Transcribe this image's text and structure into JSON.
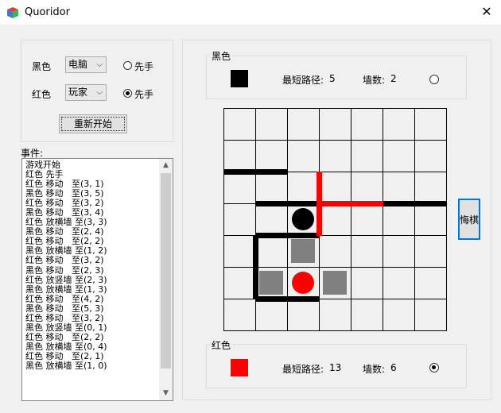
{
  "window": {
    "title": "Quoridor",
    "close_glyph": "✕"
  },
  "settings": {
    "black_label": "黑色",
    "black_controller": "电脑",
    "red_label": "红色",
    "red_controller": "玩家",
    "first_label": "先手",
    "black_first_selected": false,
    "red_first_selected": true,
    "restart_label": "重新开始"
  },
  "events": {
    "label": "事件:",
    "items": [
      "游戏开始",
      "红色 先手",
      "红色 移动   至(3, 1)",
      "黑色 移动   至(3, 5)",
      "红色 移动   至(3, 2)",
      "黑色 移动   至(3, 4)",
      "红色 放横墙 至(3, 3)",
      "黑色 移动   至(2, 4)",
      "红色 移动   至(2, 2)",
      "黑色 放横墙 至(1, 2)",
      "红色 移动   至(3, 2)",
      "黑色 移动   至(2, 3)",
      "红色 放竖墙 至(2, 3)",
      "黑色 放横墙 至(1, 3)",
      "红色 移动   至(4, 2)",
      "黑色 移动   至(5, 3)",
      "红色 移动   至(3, 2)",
      "黑色 放竖墙 至(0, 1)",
      "红色 移动   至(2, 2)",
      "黑色 放横墙 至(0, 4)",
      "红色 移动   至(2, 1)",
      "黑色 放横墙 至(1, 0)"
    ]
  },
  "black_player": {
    "label": "黑色",
    "color": "#000000",
    "shortest_label": "最短路径:",
    "shortest_value": "5",
    "walls_label": "墙数:",
    "walls_value": "2",
    "active": false
  },
  "red_player": {
    "label": "红色",
    "color": "#ff0000",
    "shortest_label": "最短路径:",
    "shortest_value": "13",
    "walls_label": "墙数:",
    "walls_value": "6",
    "active": true
  },
  "undo_label": "悔棋",
  "board": {
    "cols": 7,
    "rows": 7,
    "black_pawn": {
      "col": 2,
      "row": 3
    },
    "red_pawn": {
      "col": 2,
      "row": 5
    },
    "hints": [
      {
        "col": 2,
        "row": 4
      },
      {
        "col": 1,
        "row": 5
      },
      {
        "col": 3,
        "row": 5
      }
    ],
    "walls": [
      {
        "dir": "h",
        "row": 2,
        "col": 0,
        "len": 2,
        "color": "#000000"
      },
      {
        "dir": "h",
        "row": 3,
        "col": 1,
        "len": 2,
        "color": "#000000"
      },
      {
        "dir": "h",
        "row": 3,
        "col": 5,
        "len": 2,
        "color": "#000000"
      },
      {
        "dir": "h",
        "row": 4,
        "col": 1,
        "len": 2,
        "color": "#000000"
      },
      {
        "dir": "h",
        "row": 6,
        "col": 1,
        "len": 2,
        "color": "#000000"
      },
      {
        "dir": "v",
        "col": 1,
        "row": 4,
        "len": 2,
        "color": "#000000"
      },
      {
        "dir": "h",
        "row": 3,
        "col": 3,
        "len": 2,
        "color": "#ff0000"
      },
      {
        "dir": "v",
        "col": 3,
        "row": 2,
        "len": 2,
        "color": "#ff0000"
      }
    ]
  }
}
